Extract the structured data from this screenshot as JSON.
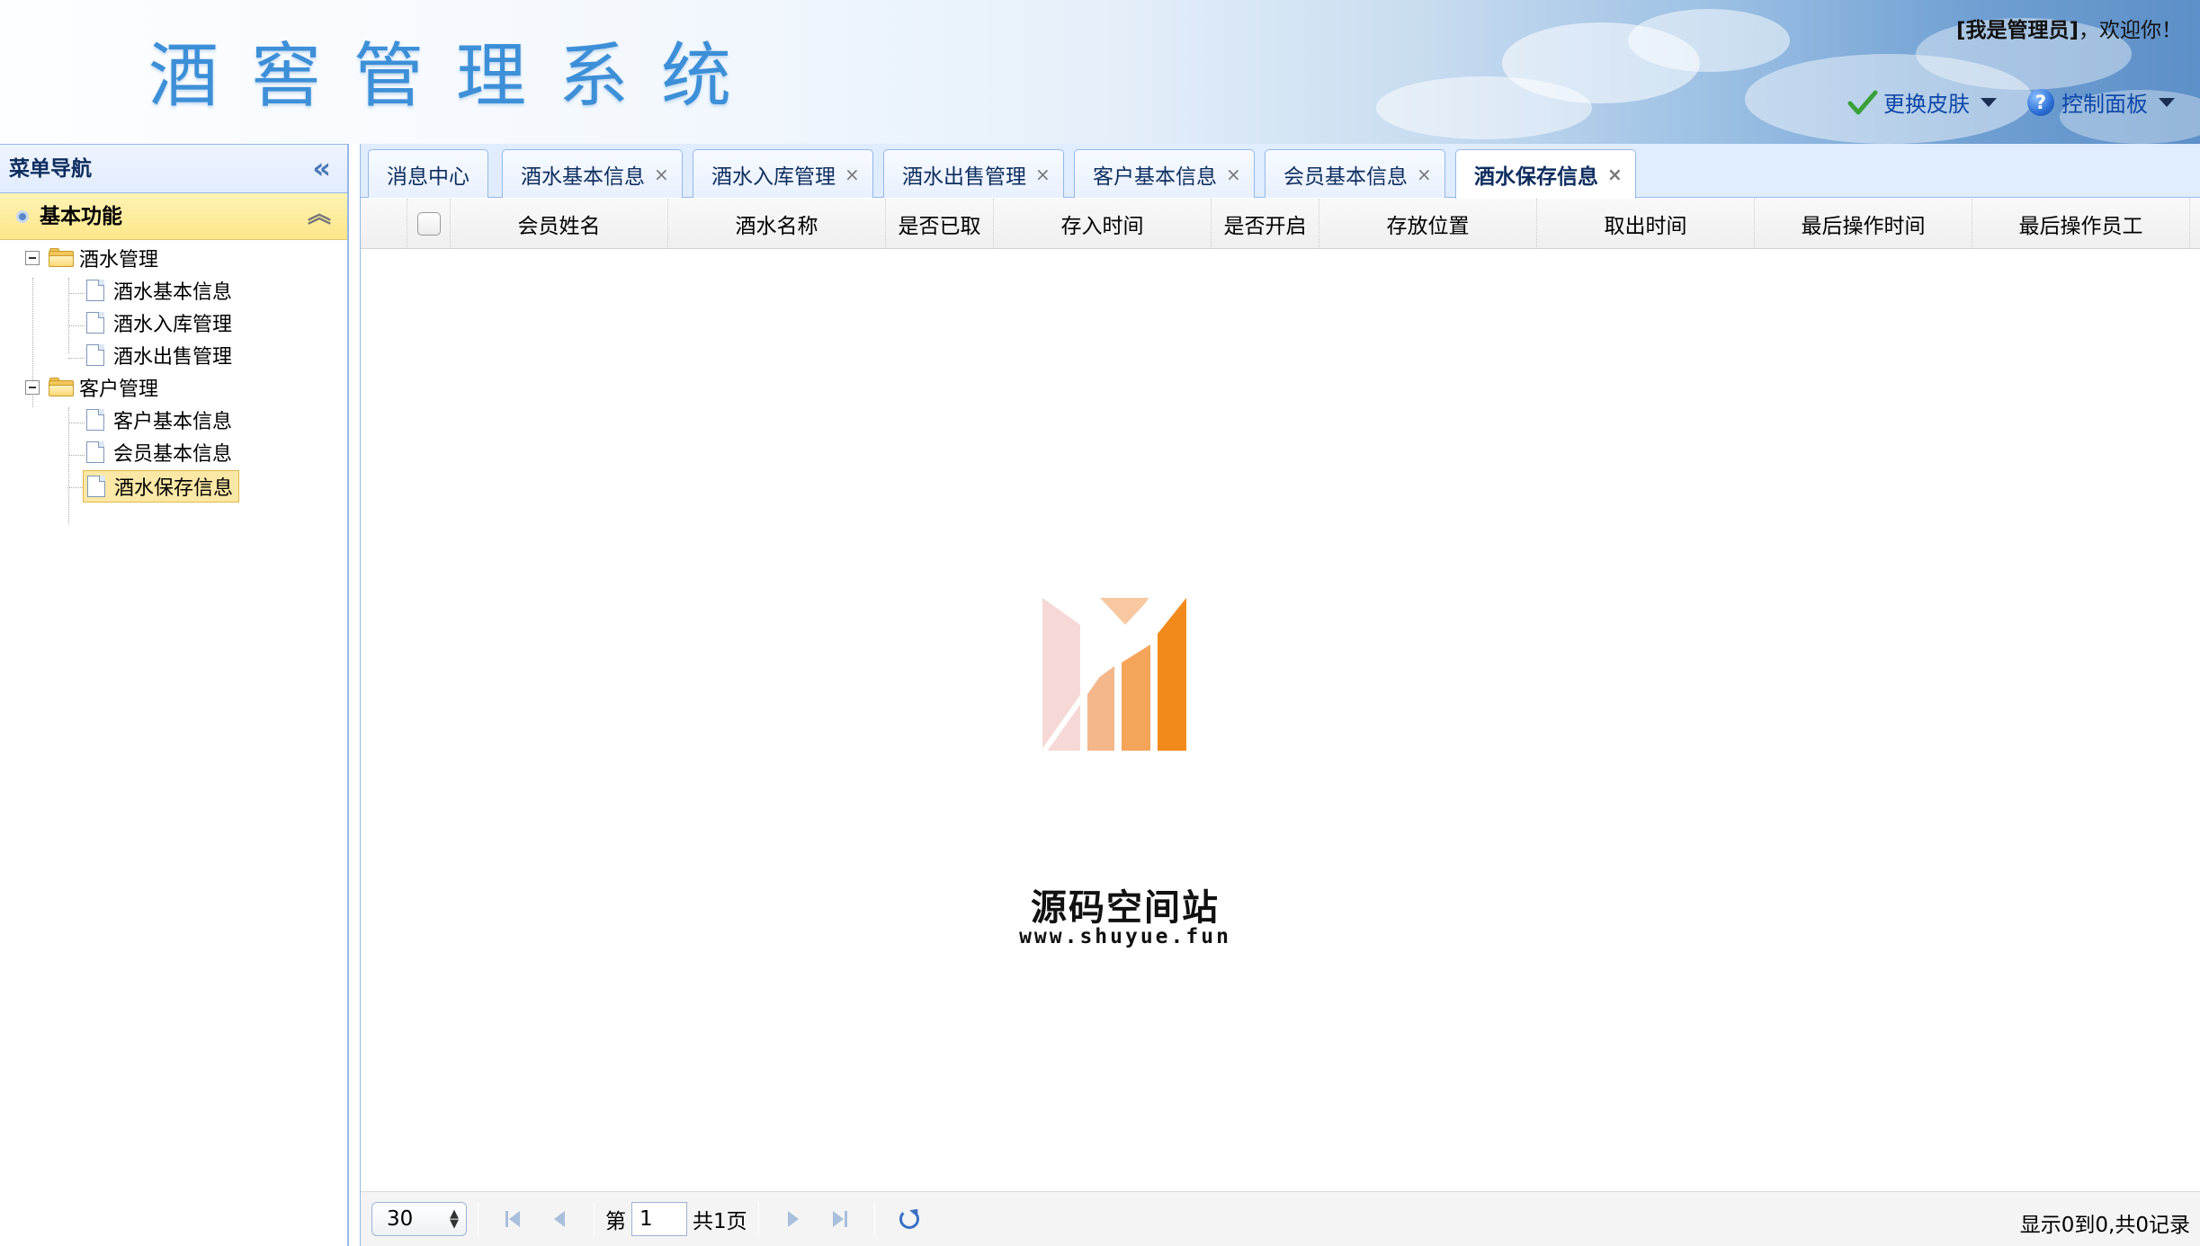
{
  "header": {
    "app_title": "酒窖管理系统",
    "welcome_user": "[我是管理员]",
    "welcome_suffix": "，欢迎你！",
    "skin_menu_label": "更换皮肤",
    "control_panel_label": "控制面板",
    "skin_icon": "check-icon",
    "control_panel_icon": "help-icon"
  },
  "sidebar": {
    "title": "菜单导航",
    "section_title": "基本功能",
    "tree": [
      {
        "label": "酒水管理",
        "children": [
          {
            "label": "酒水基本信息"
          },
          {
            "label": "酒水入库管理"
          },
          {
            "label": "酒水出售管理"
          }
        ]
      },
      {
        "label": "客户管理",
        "children": [
          {
            "label": "客户基本信息"
          },
          {
            "label": "会员基本信息"
          },
          {
            "label": "酒水保存信息",
            "selected": true
          }
        ]
      }
    ]
  },
  "tabs": [
    {
      "label": "消息中心",
      "closable": false
    },
    {
      "label": "酒水基本信息",
      "closable": true
    },
    {
      "label": "酒水入库管理",
      "closable": true
    },
    {
      "label": "酒水出售管理",
      "closable": true
    },
    {
      "label": "客户基本信息",
      "closable": true
    },
    {
      "label": "会员基本信息",
      "closable": true
    },
    {
      "label": "酒水保存信息",
      "closable": true,
      "active": true
    }
  ],
  "tab_close_glyph": "×",
  "grid": {
    "columns": [
      "会员姓名",
      "酒水名称",
      "是否已取",
      "存入时间",
      "是否开启",
      "存放位置",
      "取出时间",
      "最后操作时间",
      "最后操作员工"
    ],
    "rows": []
  },
  "watermark": {
    "name": "源码空间站",
    "url": "www.shuyue.fun"
  },
  "pager": {
    "page_size": "30",
    "page_prefix": "第",
    "current_page": "1",
    "total_pages_text": "共1页",
    "info": "显示0到0,共0记录"
  },
  "colors": {
    "accent": "#95b8e7",
    "title_blue": "#3d8fd8",
    "selected_bg": "#fbe8a6",
    "logo_orange": "#f28a1b"
  }
}
